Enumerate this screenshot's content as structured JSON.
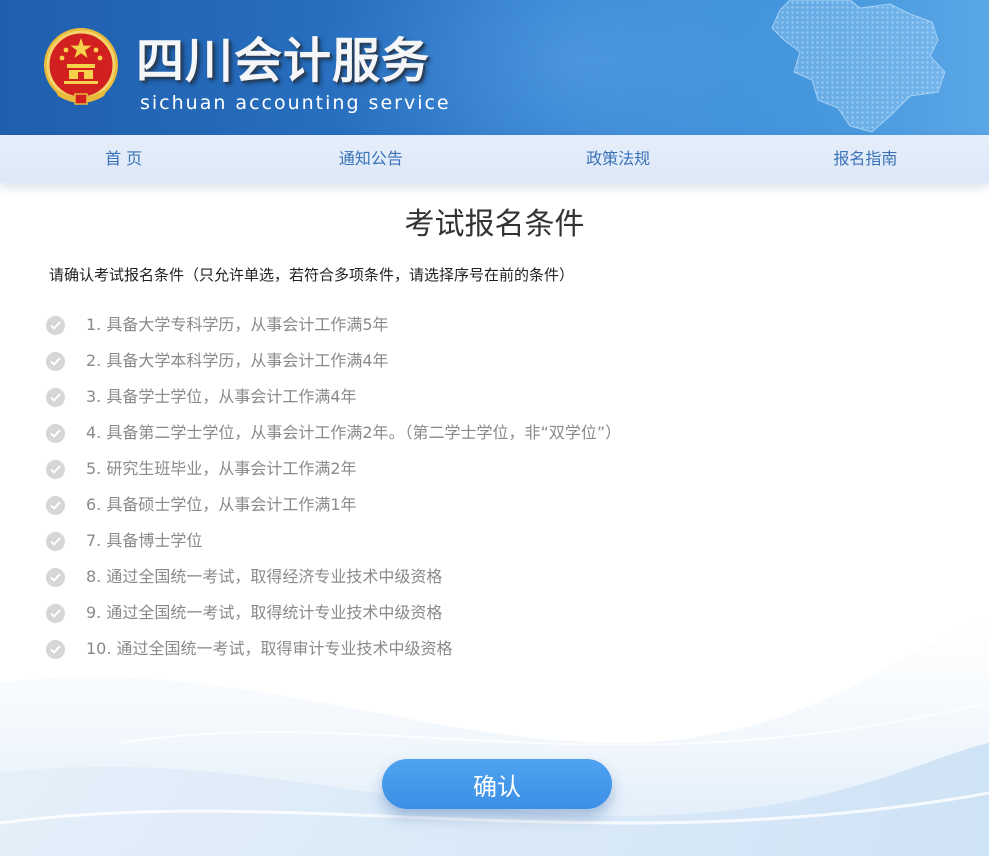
{
  "header": {
    "title": "四川会计服务",
    "subtitle": "sichuan accounting service"
  },
  "nav": {
    "items": [
      {
        "label": "首 页"
      },
      {
        "label": "通知公告"
      },
      {
        "label": "政策法规"
      },
      {
        "label": "报名指南"
      }
    ]
  },
  "main": {
    "title": "考试报名条件",
    "instruction": "请确认考试报名条件（只允许单选，若符合多项条件，请选择序号在前的条件）",
    "options": [
      {
        "label": "1. 具备大学专科学历，从事会计工作满5年",
        "selected": false
      },
      {
        "label": "2. 具备大学本科学历，从事会计工作满4年",
        "selected": false
      },
      {
        "label": "3. 具备学士学位，从事会计工作满4年",
        "selected": false
      },
      {
        "label": "4. 具备第二学士学位，从事会计工作满2年。（第二学士学位，非“双学位”）",
        "selected": false
      },
      {
        "label": "5. 研究生班毕业，从事会计工作满2年",
        "selected": false
      },
      {
        "label": "6. 具备硕士学位，从事会计工作满1年",
        "selected": false
      },
      {
        "label": "7. 具备博士学位",
        "selected": false
      },
      {
        "label": "8. 通过全国统一考试，取得经济专业技术中级资格",
        "selected": false
      },
      {
        "label": "9. 通过全国统一考试，取得统计专业技术中级资格",
        "selected": false
      },
      {
        "label": "10. 通过全国统一考试，取得审计专业技术中级资格",
        "selected": false
      }
    ],
    "confirm_label": "确认"
  },
  "colors": {
    "header_blue": "#2a74c4",
    "nav_bg": "#e6eefb",
    "nav_text": "#3a72b5",
    "button_blue": "#4fa3f0",
    "check_gray": "#d6d6d6"
  },
  "icons": {
    "emblem": "national-emblem",
    "map": "sichuan-map",
    "option_check": "check-circle-icon"
  }
}
